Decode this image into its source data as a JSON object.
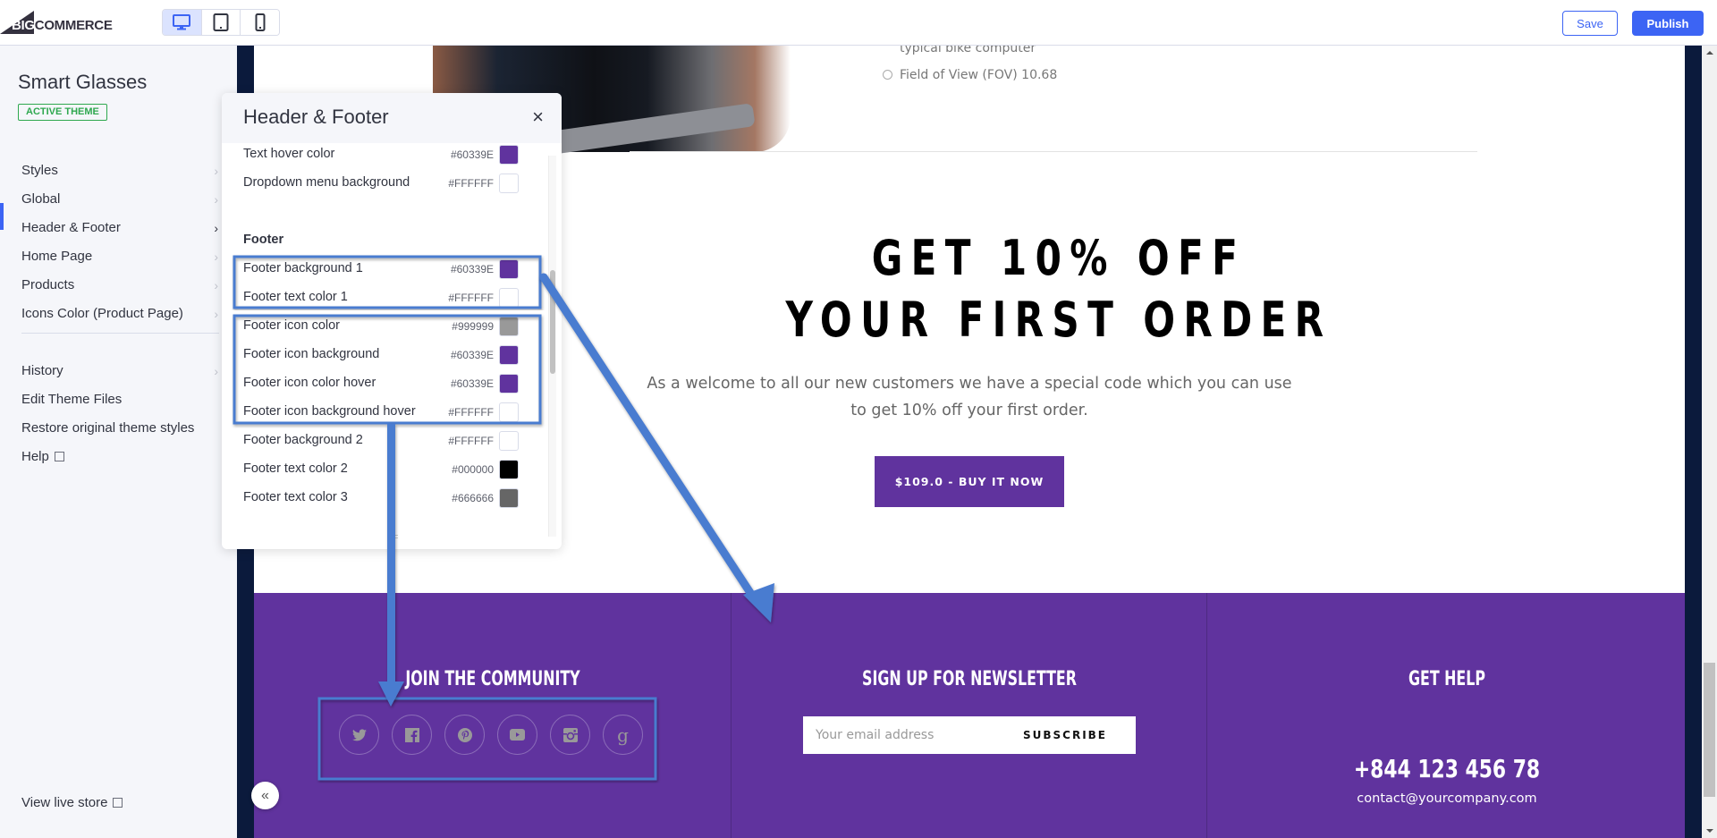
{
  "topbar": {
    "logo_big": "BIG",
    "logo_rest": "COMMERCE",
    "devices": [
      {
        "name": "desktop",
        "active": true
      },
      {
        "name": "tablet",
        "active": false
      },
      {
        "name": "mobile",
        "active": false
      }
    ],
    "save_label": "Save",
    "publish_label": "Publish"
  },
  "sidebar": {
    "theme_name": "Smart Glasses",
    "badge": "ACTIVE THEME",
    "items": [
      {
        "label": "Styles",
        "chevron": true
      },
      {
        "label": "Global",
        "chevron": true
      },
      {
        "label": "Header & Footer",
        "chevron": true,
        "active": true
      },
      {
        "label": "Home Page",
        "chevron": true
      },
      {
        "label": "Products",
        "chevron": true
      },
      {
        "label": "Icons Color (Product Page)",
        "chevron": true
      }
    ],
    "secondary": [
      {
        "label": "History",
        "chevron": true
      },
      {
        "label": "Edit Theme Files"
      },
      {
        "label": "Restore original theme styles"
      },
      {
        "label": "Help",
        "external": true
      }
    ],
    "view_live": "View live store",
    "chevron_glyph": "›"
  },
  "panel": {
    "title": "Header & Footer",
    "close": "×",
    "rows_top": [
      {
        "label": "Text hover color",
        "hex": "#60339E"
      },
      {
        "label": "Dropdown menu background",
        "hex": "#FFFFFF"
      }
    ],
    "section": "Footer",
    "rows_footer": [
      {
        "label": "Footer background 1",
        "hex": "#60339E"
      },
      {
        "label": "Footer text color 1",
        "hex": "#FFFFFF"
      },
      {
        "label": "Footer icon color",
        "hex": "#999999"
      },
      {
        "label": "Footer icon background",
        "hex": "#60339E"
      },
      {
        "label": "Footer icon color hover",
        "hex": "#60339E"
      },
      {
        "label": "Footer icon background hover",
        "hex": "#FFFFFF"
      },
      {
        "label": "Footer background 2",
        "hex": "#FFFFFF"
      },
      {
        "label": "Footer text color 2",
        "hex": "#000000"
      },
      {
        "label": "Footer text color 3",
        "hex": "#666666"
      }
    ]
  },
  "preview": {
    "spec_partial": "typical bike computer",
    "spec_fov": "Field of View (FOV) 10.68",
    "promo_line1": "GET 10% OFF",
    "promo_line2": "YOUR FIRST ORDER",
    "promo_desc": "As a welcome to all our new customers we have a special code which you can use to get 10% off your first order.",
    "buy_button": "$109.0 - BUY IT NOW",
    "footer": {
      "community_heading": "JOIN THE COMMUNITY",
      "social": [
        {
          "name": "twitter",
          "glyph": "🐦"
        },
        {
          "name": "facebook",
          "glyph": "f"
        },
        {
          "name": "pinterest",
          "glyph": "p"
        },
        {
          "name": "youtube",
          "glyph": "▶"
        },
        {
          "name": "instagram",
          "glyph": "◙"
        },
        {
          "name": "google",
          "glyph": "g"
        }
      ],
      "newsletter_heading": "SIGN UP FOR NEWSLETTER",
      "email_placeholder": "Your email address",
      "subscribe": "SUBSCRIBE",
      "help_heading": "GET HELP",
      "phone": "+844 123 456 78",
      "email": "contact@yourcompany.com"
    },
    "collapse": "«"
  },
  "colors": {
    "accent": "#3c64f4",
    "brand_purple": "#60339E",
    "annotation_blue": "#4a7bd0"
  }
}
